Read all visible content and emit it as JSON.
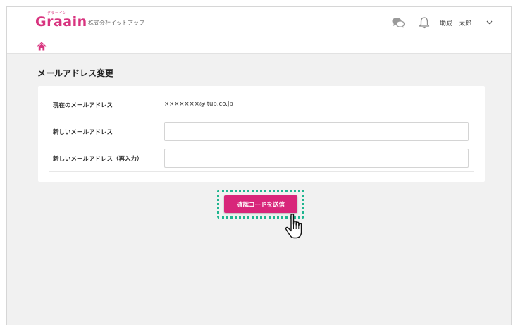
{
  "header": {
    "logo_text": "Graain",
    "logo_ruby": "グラーイン",
    "company": "株式会社イットアップ",
    "user_name": "助成　太郎",
    "icons": [
      "chat-icon",
      "bell-icon",
      "chevron-down-icon"
    ]
  },
  "breadcrumb": {
    "home_icon": "home-icon"
  },
  "main": {
    "title": "メールアドレス変更",
    "rows": [
      {
        "label": "現在のメールアドレス",
        "value": "×××××××@itup.co.jp"
      },
      {
        "label": "新しいメールアドレス",
        "value": ""
      },
      {
        "label": "新しいメールアドレス（再入力）",
        "value": ""
      }
    ],
    "submit_label": "確認コードを送信"
  },
  "colors": {
    "brand": "#d8347f",
    "button": "#d8267a",
    "highlight": "#1fb58f",
    "background": "#f1f1f1"
  }
}
